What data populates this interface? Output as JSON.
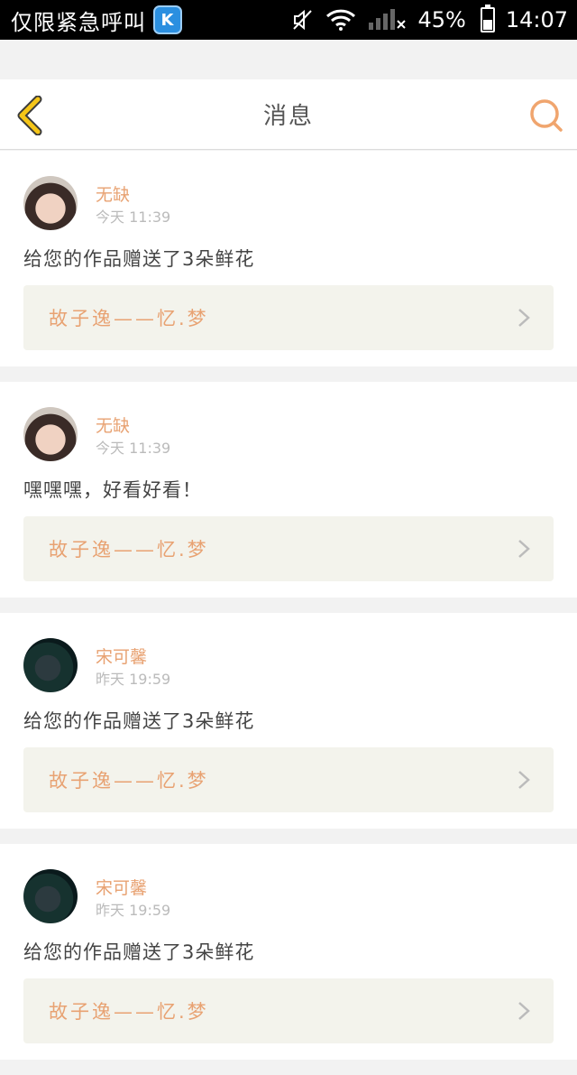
{
  "status_bar": {
    "carrier": "仅限紧急呼叫",
    "app_badge": "K",
    "battery": "45%",
    "time": "14:07"
  },
  "header": {
    "title": "消息"
  },
  "messages": [
    {
      "user": "无缺",
      "time": "今天 11:39",
      "text": "给您的作品赠送了3朵鲜花",
      "work": "故子逸——忆.梦"
    },
    {
      "user": "无缺",
      "time": "今天 11:39",
      "text": "嘿嘿嘿，好看好看！",
      "work": "故子逸——忆.梦"
    },
    {
      "user": "宋可馨",
      "time": "昨天 19:59",
      "text": "给您的作品赠送了3朵鲜花",
      "work": "故子逸——忆.梦"
    },
    {
      "user": "宋可馨",
      "time": "昨天 19:59",
      "text": "给您的作品赠送了3朵鲜花",
      "work": "故子逸——忆.梦"
    }
  ],
  "colors": {
    "accent": "#e8a272",
    "back_arrow": "#f5c518",
    "background": "#f2f2f2"
  }
}
